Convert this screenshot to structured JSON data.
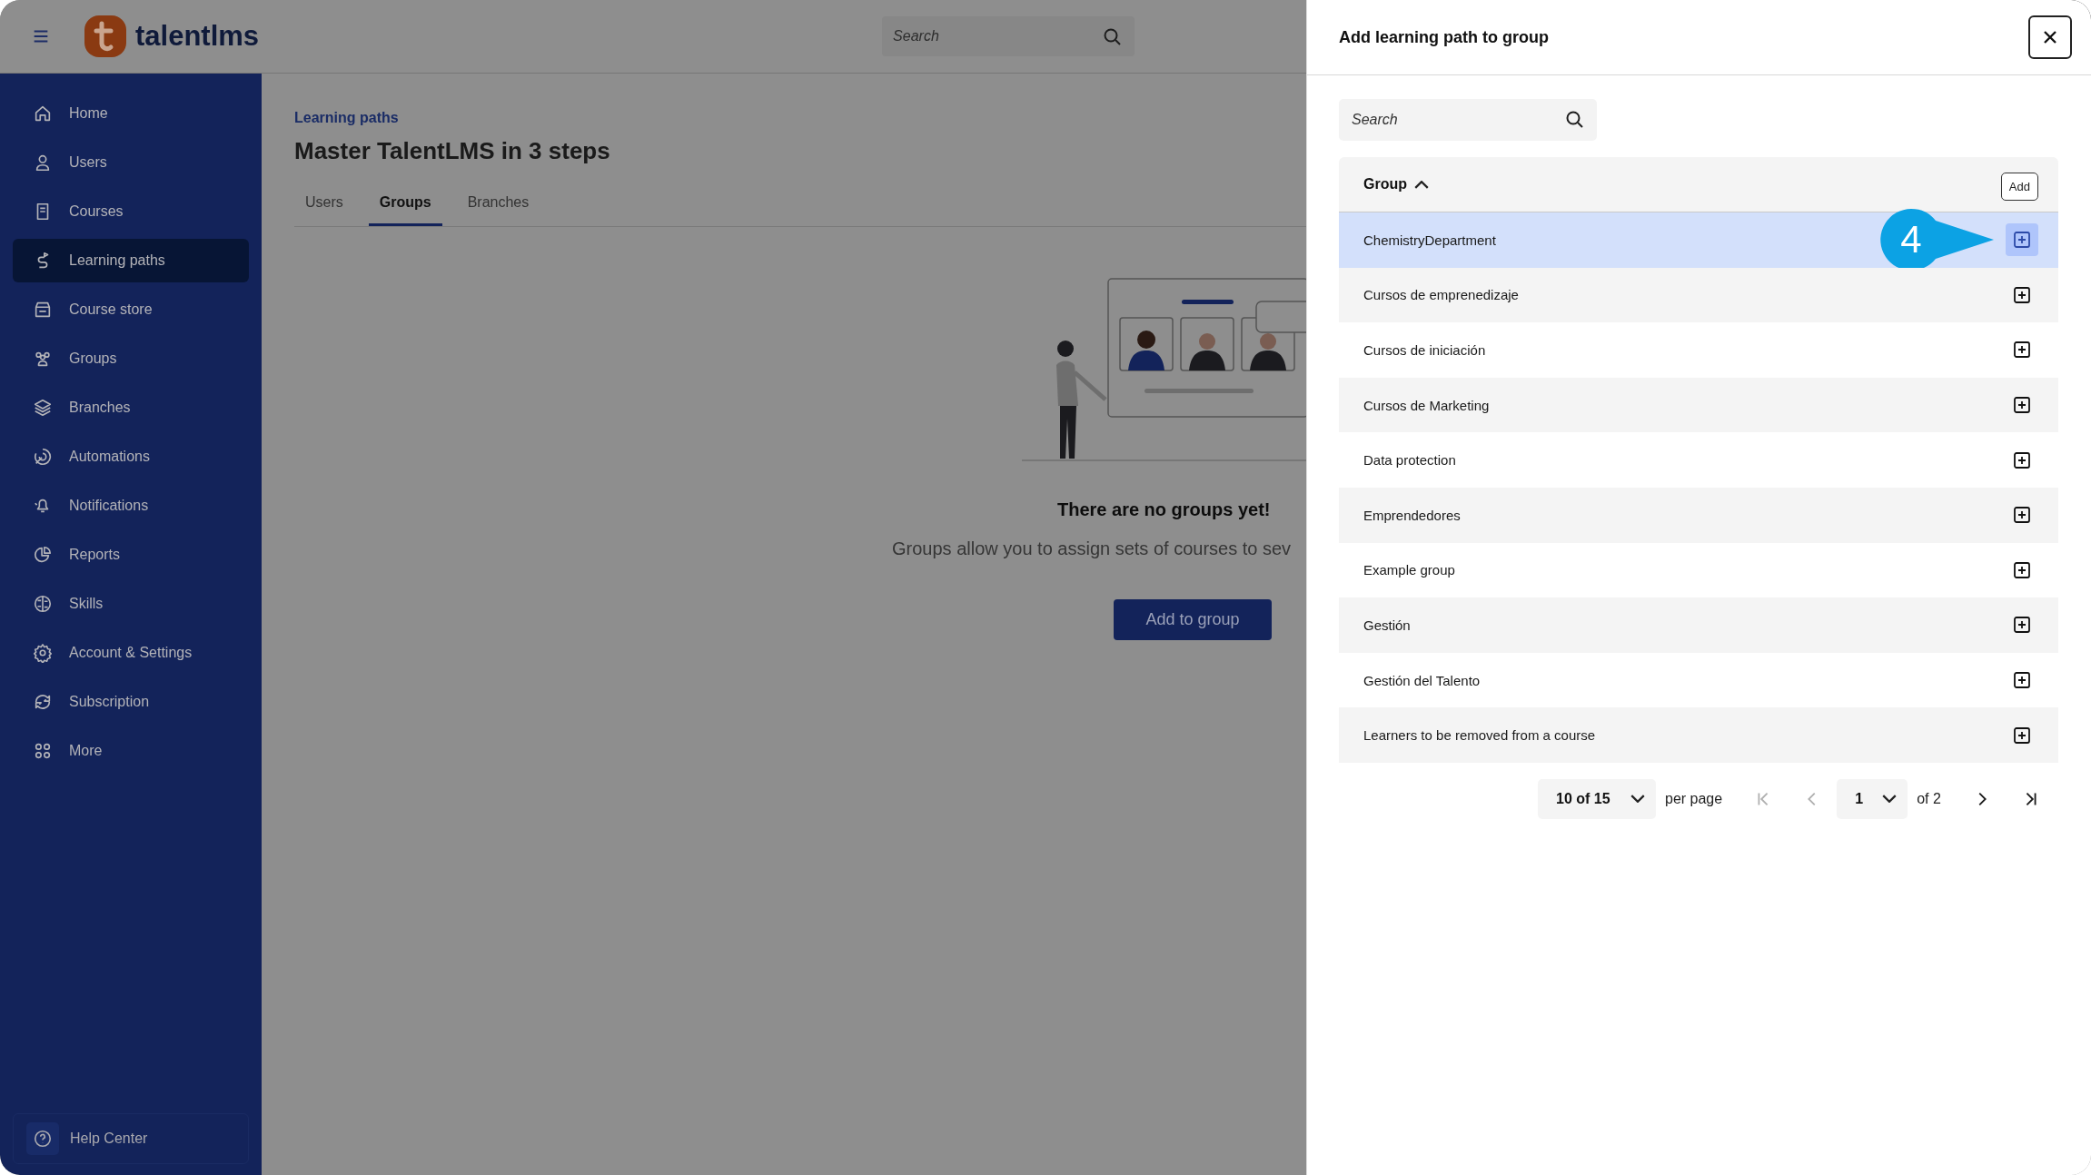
{
  "header": {
    "logo_text": "talentlms",
    "search": {
      "placeholder": "Search"
    }
  },
  "sidebar": {
    "items": [
      {
        "label": "Home",
        "selected": false
      },
      {
        "label": "Users",
        "selected": false
      },
      {
        "label": "Courses",
        "selected": false
      },
      {
        "label": "Learning paths",
        "selected": true
      },
      {
        "label": "Course store",
        "selected": false
      },
      {
        "label": "Groups",
        "selected": false
      },
      {
        "label": "Branches",
        "selected": false
      },
      {
        "label": "Automations",
        "selected": false
      },
      {
        "label": "Notifications",
        "selected": false
      },
      {
        "label": "Reports",
        "selected": false
      },
      {
        "label": "Skills",
        "selected": false
      },
      {
        "label": "Account & Settings",
        "selected": false
      },
      {
        "label": "Subscription",
        "selected": false
      },
      {
        "label": "More",
        "selected": false
      }
    ],
    "help": "Help Center"
  },
  "page": {
    "breadcrumb": "Learning paths",
    "title": "Master TalentLMS in 3 steps",
    "tabs": [
      {
        "label": "Users",
        "selected": false
      },
      {
        "label": "Groups",
        "selected": true
      },
      {
        "label": "Branches",
        "selected": false
      }
    ],
    "empty_state": {
      "heading": "There are no groups yet!",
      "description": "Groups allow you to assign sets of courses to sev",
      "button": "Add to group"
    }
  },
  "panel": {
    "title": "Add learning path to group",
    "search": {
      "placeholder": "Search"
    },
    "table": {
      "column": "Group",
      "tooltip": "Add",
      "callout": "4",
      "rows": [
        {
          "name": "ChemistryDepartment",
          "selected": true
        },
        {
          "name": "Cursos de emprenedizaje",
          "selected": false
        },
        {
          "name": "Cursos de iniciación",
          "selected": false
        },
        {
          "name": "Cursos de Marketing",
          "selected": false
        },
        {
          "name": "Data protection",
          "selected": false
        },
        {
          "name": "Emprendedores",
          "selected": false
        },
        {
          "name": "Example group",
          "selected": false
        },
        {
          "name": "Gestión",
          "selected": false
        },
        {
          "name": "Gestión del Talento",
          "selected": false
        },
        {
          "name": "Learners to be removed from a course",
          "selected": false
        }
      ]
    },
    "pagination": {
      "per_page": "10 of 15",
      "per_page_label": "per page",
      "page": "1",
      "page_total": "of 2",
      "nav": [
        {
          "kind": "first",
          "disabled": true
        },
        {
          "kind": "prev",
          "disabled": true
        },
        {
          "kind": "next",
          "disabled": false
        },
        {
          "kind": "last",
          "disabled": false
        }
      ]
    }
  }
}
